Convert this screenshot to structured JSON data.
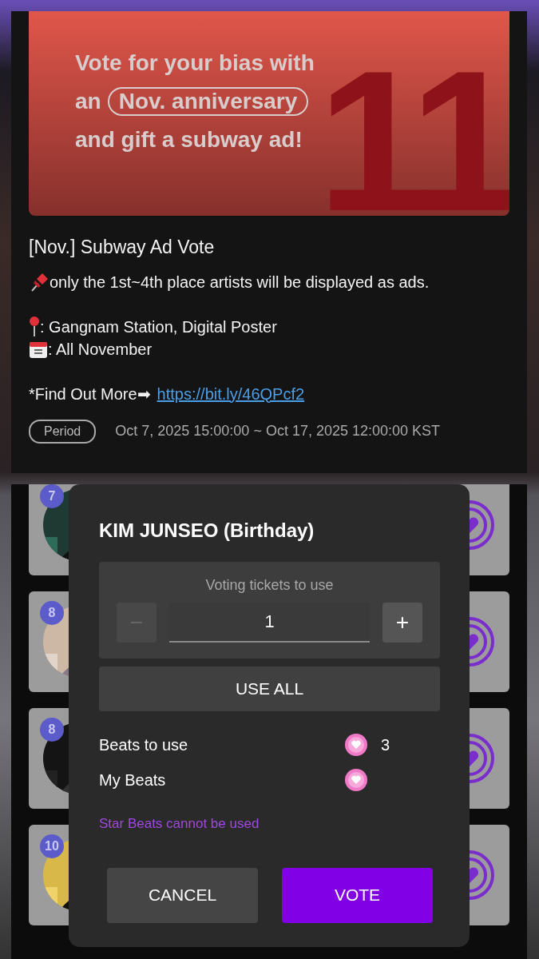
{
  "banner": {
    "line_1": "Vote for your bias with",
    "line_2_prefix": "an",
    "highlight": "Nov. anniversary",
    "line_3": "and gift a subway ad!",
    "big_number": "11"
  },
  "post": {
    "title": "[Nov.] Subway Ad Vote",
    "paragraphs": [
      [
        {
          "kind": "pushpin",
          "text": "only the 1st~4th place artists will be displayed as ads."
        }
      ],
      [
        {
          "kind": "location",
          "text": ": Gangnam Station, Digital Poster"
        },
        {
          "kind": "calendar",
          "text": ": All November"
        }
      ]
    ],
    "more": {
      "text": "*Find Out More➡",
      "link": "https://bit.ly/46QPcf2"
    },
    "period": {
      "badge": "Period",
      "range": "Oct 7, 2025 15:00:00 ~ Oct 17, 2025 12:00:00 KST"
    }
  },
  "ranking": [
    {
      "rank": "7"
    },
    {
      "rank": "8"
    },
    {
      "rank": "8"
    },
    {
      "rank": "10"
    }
  ],
  "dialog": {
    "title": "KIM JUNSEO (Birthday)",
    "stepper": {
      "label": "Voting tickets to use",
      "value": "1",
      "minus": {
        "symbol": "−",
        "disabled": true
      },
      "plus": {
        "symbol": "+",
        "disabled": false
      }
    },
    "use_all": "USE ALL",
    "beats": [
      {
        "label": "Beats to use",
        "value": "3"
      },
      {
        "label": "My Beats"
      }
    ],
    "notice": "Star Beats cannot be used",
    "buttons": [
      {
        "label": "CANCEL",
        "kind": "secondary"
      },
      {
        "label": "VOTE",
        "kind": "primary"
      }
    ]
  }
}
